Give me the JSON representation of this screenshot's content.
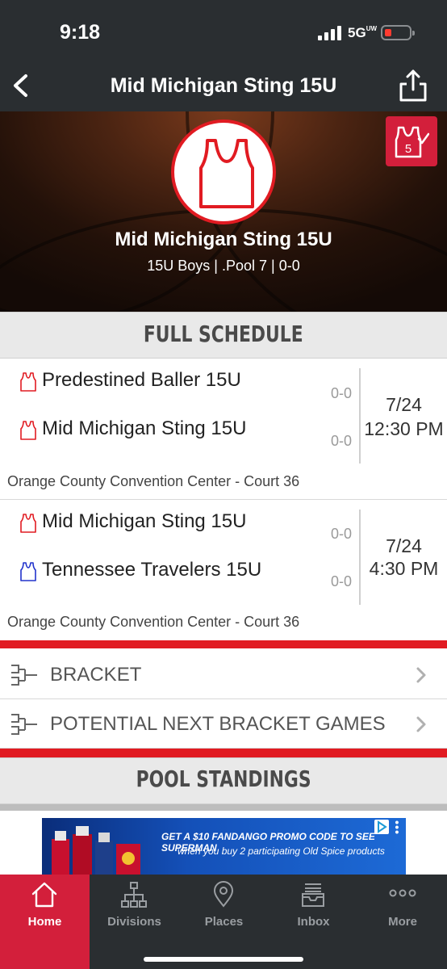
{
  "status_bar": {
    "time": "9:18",
    "network": "5G",
    "network_sup": "UW"
  },
  "nav": {
    "title": "Mid Michigan Sting 15U",
    "back_icon": "chevron-left-icon",
    "share_icon": "share-icon"
  },
  "team": {
    "name": "Mid Michigan Sting 15U",
    "meta": "15U Boys | .Pool 7 | 0-0",
    "badge_number": "5"
  },
  "schedule": {
    "header": "FULL SCHEDULE",
    "games": [
      {
        "teams": [
          {
            "name": "Predestined Baller 15U",
            "score": "0-0",
            "jersey_color": "#e11b22"
          },
          {
            "name": "Mid Michigan Sting 15U",
            "score": "0-0",
            "jersey_color": "#e11b22"
          }
        ],
        "date": "7/24",
        "time": "12:30 PM",
        "venue": "Orange County Convention Center - Court 36"
      },
      {
        "teams": [
          {
            "name": "Mid Michigan Sting 15U",
            "score": "0-0",
            "jersey_color": "#e11b22"
          },
          {
            "name": "Tennessee Travelers 15U",
            "score": "0-0",
            "jersey_color": "#2233cc"
          }
        ],
        "date": "7/24",
        "time": "4:30 PM",
        "venue": "Orange County Convention Center - Court 36"
      }
    ]
  },
  "menu": [
    {
      "label": "BRACKET",
      "icon": "bracket-icon"
    },
    {
      "label": "POTENTIAL NEXT BRACKET GAMES",
      "icon": "bracket-icon"
    }
  ],
  "pool": {
    "header": "POOL STANDINGS"
  },
  "ad": {
    "line1": "GET A $10 FANDANGO PROMO CODE TO SEE SUPERMAN",
    "line2": "when you buy 2 participating Old Spice products"
  },
  "tabs": [
    {
      "label": "Home",
      "icon": "home-icon",
      "active": true
    },
    {
      "label": "Divisions",
      "icon": "divisions-icon",
      "active": false
    },
    {
      "label": "Places",
      "icon": "map-pin-icon",
      "active": false
    },
    {
      "label": "Inbox",
      "icon": "inbox-icon",
      "active": false
    },
    {
      "label": "More",
      "icon": "more-icon",
      "active": false
    }
  ],
  "colors": {
    "accent": "#e11b22",
    "tab_active": "#d31f3b",
    "bar": "#2a2e31"
  }
}
